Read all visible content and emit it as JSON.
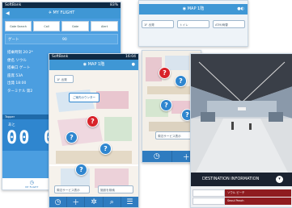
{
  "screen1": {
    "status": {
      "carrier": "SoftBank",
      "time": "",
      "battery": "83%"
    },
    "title": "MY FLIGHT",
    "segments": [
      "Gate Search",
      "Call",
      "Gate",
      "Alert"
    ],
    "flight_label": "ゲート",
    "flight_value": "90",
    "info_lines": [
      "搭乗時刻 20:2*",
      "便名 ソウル",
      "搭乗口 ゲート",
      "座席 53A",
      "出発 18:00",
      "ターミナル 第2"
    ],
    "countdown_header": "Tapper",
    "countdown_label": "あと",
    "countdown": "00 00",
    "nav": [
      {
        "icon": "clock",
        "label": "MY FLIGHT"
      },
      {
        "icon": "plus",
        "label": ""
      }
    ]
  },
  "screen2": {
    "status": {
      "carrier": "SoftBank",
      "time": "16:04",
      "battery": ""
    },
    "title": "MAP 1階",
    "floor_button": "1F 出発",
    "callout": "ご案内カウンター",
    "nearby_button": "周辺サービス表示",
    "search_button": "施設を検索",
    "nav": [
      "clock",
      "plus",
      "star",
      "search",
      "menu"
    ]
  },
  "screen3": {
    "pin_labels": [
      "?",
      "?",
      "?",
      "?"
    ],
    "nearby_button": "周辺サービス表示",
    "nav": [
      "clock",
      "plus"
    ]
  },
  "screen4": {
    "title": "MAP 1階",
    "buttons": [
      "1F 出発",
      "トイレ",
      "ATM/両替"
    ]
  },
  "screen5": {
    "destination_header": "DESTINATION INFORMATION",
    "rows": [
      {
        "time": "",
        "dest": "ソウル ピーチ"
      },
      {
        "time": "",
        "dest": "Seoul Peach"
      }
    ]
  }
}
